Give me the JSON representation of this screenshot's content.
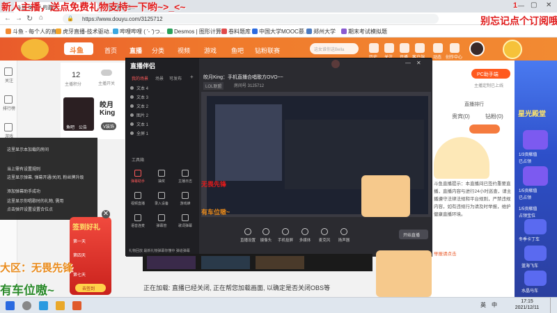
{
  "overlay": {
    "top_left_text": "新人主播，送点免费礼物支持一下哟~>_<~",
    "top_right_text": "别忘记点个订阅哦~",
    "top_right_counter": "1",
    "bottom_left_line1": "大区：无畏先锋",
    "bottom_left_line2": "有车位嗷~"
  },
  "browser": {
    "tabs": [
      "斗鱼-每个人的直播...",
      "斗鱼直播伴侣..."
    ],
    "url": "https://www.douyu.com/3125712",
    "bookmarks": [
      "斗鱼 - 每个人的直...",
      "虎牙直播-技术驱动...",
      "哔哩哔哩 ( '- ')つ...",
      "Desmos | 图形计算器",
      "卷料题库",
      "中国大学MOOC慕...",
      "郑州大学",
      "期末考试模拟题"
    ]
  },
  "site": {
    "logo": "斗鱼",
    "nav": [
      "首页",
      "直播",
      "分类",
      "视频",
      "游戏",
      "鱼吧",
      "钻粉联赛"
    ],
    "search_placeholder": "这女谁你这Bella",
    "header_icons": [
      "历史",
      "关注",
      "开播",
      "客户端",
      "动态",
      "创作中心"
    ],
    "sidebar": [
      "关注",
      "排行榜",
      "游戏"
    ],
    "card": {
      "fans_count": "12",
      "fans_label": "主播积分",
      "streamer_name": "皎月King",
      "badge": "V装饰",
      "toggle_label": "主播开关",
      "tag1": "鱼吧",
      "tag2": "公告"
    },
    "right_panel": {
      "pc_button": "PC助手端",
      "pc_sub": "主播定制已上线",
      "tabs": [
        "贵宾(0)",
        "钻粉(0)"
      ],
      "notice_text": "斗鱼直播提示：本直播间已签约重要直播，直播内容与进行24小时巡查，请主播遵守法律法规和平台规则，严禁违规内容，如有违规行为请及时举报，维护健康直播环境。",
      "notice_link": "举报请点击",
      "rank_tab": "直播排行"
    },
    "right_strip": {
      "title": "星光殿堂",
      "items": [
        "1/3贡献值",
        "已占领",
        "1/5贡献值",
        "已占领",
        "1/5贡献值",
        "占领宝位",
        "冬季卡丁车",
        "蓝海飞车",
        "水晶马车"
      ]
    },
    "bottom_hint": "正在加载: 直播已经关闭, 正在帮您加载画面, 以确定是否关闭OBS等"
  },
  "obs": {
    "title": "直播伴侣",
    "left_tabs": [
      "我的场景",
      "场景",
      "可发布"
    ],
    "scenes": [
      "文本 4",
      "文本 3",
      "文本 2",
      "图片 2",
      "文本 1",
      "全屏 1"
    ],
    "tools_header": "工具箱",
    "tools": [
      "弹幕助手",
      "抽奖",
      "主播日志",
      "视频直播",
      "录入设备",
      "游戏蜂",
      "语音连麦",
      "弹幕管",
      "歌词弹幕"
    ],
    "footer": "礼物回放  最新礼物弹幕你懂中  弹道弹幕",
    "stream_title": "皎月King：手机直播合唱歌方OVO~~",
    "stream_tags": [
      "LOL联盟",
      "房间号 3125712"
    ],
    "controls": [
      "直播设置",
      "摄像头",
      "手机投屏",
      "多媒体",
      "麦克风",
      "扬声器"
    ],
    "start_button": "开始直播",
    "preview_overlay_a": "无畏先锋",
    "preview_overlay_b": "有车位嗷~"
  },
  "context_menu": {
    "items": [
      "这里显示本加载的房间",
      "当上需有设置规则",
      "这里显示弹幕, 弹幕开通/关闭, 粉丝牌升级",
      "添加弹幕助手成功",
      "这里显示你唱歌时的礼物, 需用",
      "点击弹开设置设置合位点"
    ]
  },
  "sign_widget": {
    "title": "签到好礼",
    "days": [
      "第一天",
      "第四天",
      "第七天"
    ],
    "button": "去签到"
  },
  "taskbar": {
    "time": "17:15",
    "date": "2021/12/11",
    "tray": [
      "英",
      "中"
    ]
  },
  "colors": {
    "brand": "#f07a2c",
    "overlay_red": "#e01b1b",
    "overlay_green": "#2a8a2a",
    "overlay_orange": "#e98a1a"
  }
}
